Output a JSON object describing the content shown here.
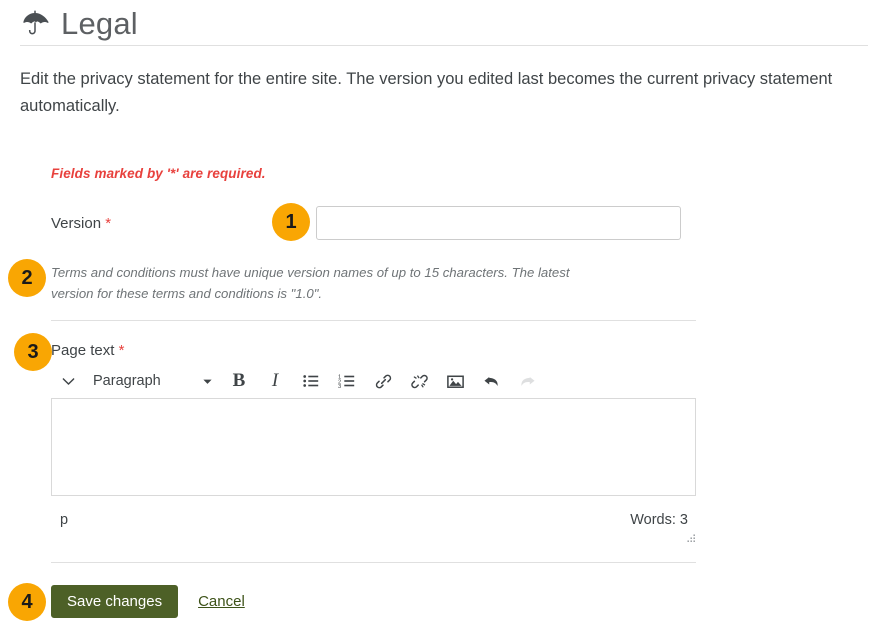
{
  "header": {
    "icon": "umbrella-icon",
    "title": "Legal"
  },
  "intro": {
    "text": "Edit the privacy statement for the entire site. The version you edited last becomes the current privacy statement automatically."
  },
  "form": {
    "required_note": "Fields marked by '*' are required.",
    "required_star": "*",
    "version": {
      "label": "Version",
      "value": "",
      "placeholder": ""
    },
    "version_help": "Terms and conditions must have unique version names of up to 15 characters. The latest version for these terms and conditions is \"1.0\".",
    "page_text": {
      "label": "Page text",
      "value": ""
    }
  },
  "editor": {
    "toolbar": {
      "toggle_icon": "chevron-down-icon",
      "format_label": "Paragraph",
      "format_caret_icon": "caret-down-icon",
      "bold_label": "B",
      "italic_label": "I",
      "bullet_list_icon": "bullet-list-icon",
      "numbered_list_icon": "numbered-list-icon",
      "link_icon": "link-icon",
      "unlink_icon": "unlink-icon",
      "image_icon": "image-icon",
      "undo_icon": "undo-icon",
      "redo_icon": "redo-icon"
    },
    "status": {
      "element_path": "p",
      "word_count": "Words: 3",
      "resize_icon": "resize-grip-icon"
    }
  },
  "actions": {
    "save_label": "Save changes",
    "cancel_label": "Cancel"
  },
  "callouts": {
    "one": "1",
    "two": "2",
    "three": "3",
    "four": "4"
  },
  "colors": {
    "badge": "#f9a603",
    "save_button": "#4d6027",
    "required_red": "#e8413d",
    "title_gray": "#5d6063",
    "rule_gray": "#e0e0e0"
  }
}
